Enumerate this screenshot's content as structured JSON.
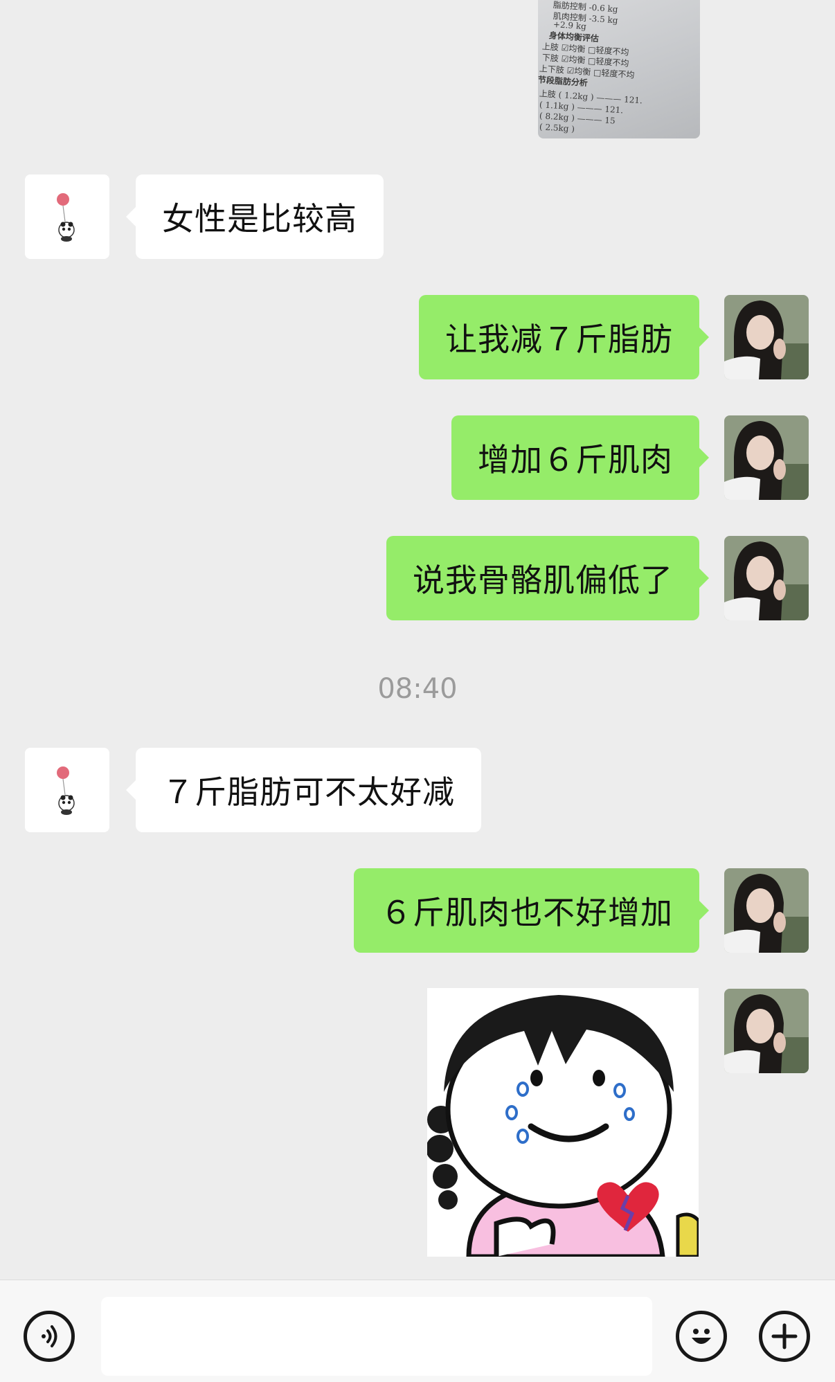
{
  "photo": {
    "lines": [
      "脂肪控制        -0.6 kg",
      "肌肉控制        -3.5 kg",
      "                +2.9 kg",
      "身体均衡评估",
      "上肢   ☑均衡   □轻度不均",
      "下肢   ☑均衡   □轻度不均",
      "上下肢 ☑均衡   □轻度不均",
      "节段脂肪分析",
      "上肢 ( 1.2kg )  ——— 121.",
      "     ( 1.1kg )  ——— 121.",
      "     ( 8.2kg )  ——— 15",
      "     ( 2.5kg )"
    ]
  },
  "messages": [
    {
      "side": "left",
      "text": "女性是比较高"
    },
    {
      "side": "right",
      "text": "让我减７斤脂肪"
    },
    {
      "side": "right",
      "text": "增加６斤肌肉"
    },
    {
      "side": "right",
      "text": "说我骨骼肌偏低了"
    },
    {
      "side": "left",
      "text": "７斤脂肪可不太好减"
    },
    {
      "side": "right",
      "text": "６斤肌肉也不好增加"
    }
  ],
  "timestamp": "08:40",
  "colors": {
    "background": "#EDEDED",
    "self_bubble": "#95EC69",
    "other_bubble": "#FFFFFF",
    "timestamp": "#9B9B9B"
  },
  "icons": {
    "voice": "voice-icon",
    "emoji": "emoji-icon",
    "more": "plus-icon"
  },
  "input": {
    "value": ""
  }
}
